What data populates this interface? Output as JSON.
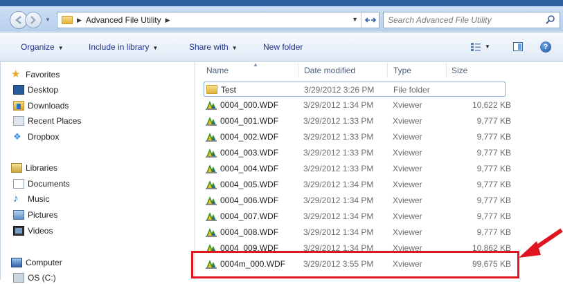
{
  "address": {
    "crumbs": [
      "Advanced File Utility"
    ]
  },
  "search": {
    "placeholder": "Search Advanced File Utility"
  },
  "toolbar": {
    "organize": "Organize",
    "include_in_library": "Include in library",
    "share_with": "Share with",
    "new_folder": "New folder"
  },
  "nav": {
    "favorites": "Favorites",
    "desktop": "Desktop",
    "downloads": "Downloads",
    "recent_places": "Recent Places",
    "dropbox": "Dropbox",
    "libraries": "Libraries",
    "documents": "Documents",
    "music": "Music",
    "pictures": "Pictures",
    "videos": "Videos",
    "computer": "Computer",
    "os_c": "OS (C:)"
  },
  "columns": {
    "name": "Name",
    "date_modified": "Date modified",
    "type": "Type",
    "size": "Size"
  },
  "files": [
    {
      "name": "Test",
      "date": "3/29/2012 3:26 PM",
      "type": "File folder",
      "size": ""
    },
    {
      "name": "0004_000.WDF",
      "date": "3/29/2012 1:34 PM",
      "type": "Xviewer",
      "size": "10,622 KB"
    },
    {
      "name": "0004_001.WDF",
      "date": "3/29/2012 1:33 PM",
      "type": "Xviewer",
      "size": "9,777 KB"
    },
    {
      "name": "0004_002.WDF",
      "date": "3/29/2012 1:33 PM",
      "type": "Xviewer",
      "size": "9,777 KB"
    },
    {
      "name": "0004_003.WDF",
      "date": "3/29/2012 1:33 PM",
      "type": "Xviewer",
      "size": "9,777 KB"
    },
    {
      "name": "0004_004.WDF",
      "date": "3/29/2012 1:33 PM",
      "type": "Xviewer",
      "size": "9,777 KB"
    },
    {
      "name": "0004_005.WDF",
      "date": "3/29/2012 1:34 PM",
      "type": "Xviewer",
      "size": "9,777 KB"
    },
    {
      "name": "0004_006.WDF",
      "date": "3/29/2012 1:34 PM",
      "type": "Xviewer",
      "size": "9,777 KB"
    },
    {
      "name": "0004_007.WDF",
      "date": "3/29/2012 1:34 PM",
      "type": "Xviewer",
      "size": "9,777 KB"
    },
    {
      "name": "0004_008.WDF",
      "date": "3/29/2012 1:34 PM",
      "type": "Xviewer",
      "size": "9,777 KB"
    },
    {
      "name": "0004_009.WDF",
      "date": "3/29/2012 1:34 PM",
      "type": "Xviewer",
      "size": "10,862 KB"
    },
    {
      "name": "0004m_000.WDF",
      "date": "3/29/2012 3:55 PM",
      "type": "Xviewer",
      "size": "99,675 KB"
    }
  ],
  "colors": {
    "highlight": "#e0151f",
    "link_blue": "#1e3287"
  }
}
